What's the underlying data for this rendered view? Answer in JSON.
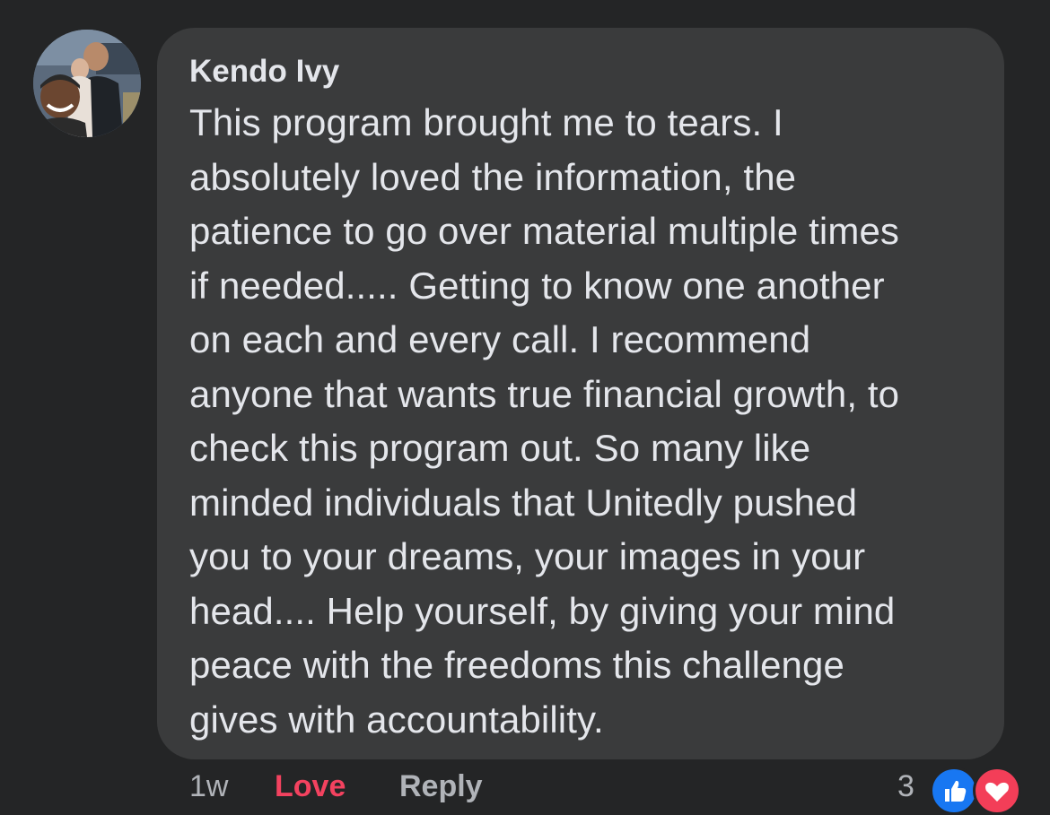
{
  "comment": {
    "author": "Kendo Ivy",
    "text": "This program brought me to tears. I\nabsolutely loved the information, the\npatience to go over material multiple times\nif needed..... Getting to know one another\non each and every call. I recommend\nanyone that wants true financial growth, to\ncheck this program out. So many like\nminded individuals that Unitedly pushed\nyou to your dreams, your images in your\nhead.... Help yourself, by giving your mind\npeace with the freedoms this challenge\ngives with accountability."
  },
  "footer": {
    "time": "1w",
    "reaction_label": "Love",
    "reply_label": "Reply",
    "reaction_count": "3"
  },
  "reactions": [
    {
      "type": "like",
      "icon": "thumbs-up-icon",
      "color": "#1877f2"
    },
    {
      "type": "love",
      "icon": "heart-icon",
      "color": "#f33e58"
    }
  ],
  "colors": {
    "background": "#242526",
    "bubble": "#3a3b3c",
    "text": "#e4e6eb",
    "secondary": "#b0b3b8",
    "love": "#f3425f"
  }
}
